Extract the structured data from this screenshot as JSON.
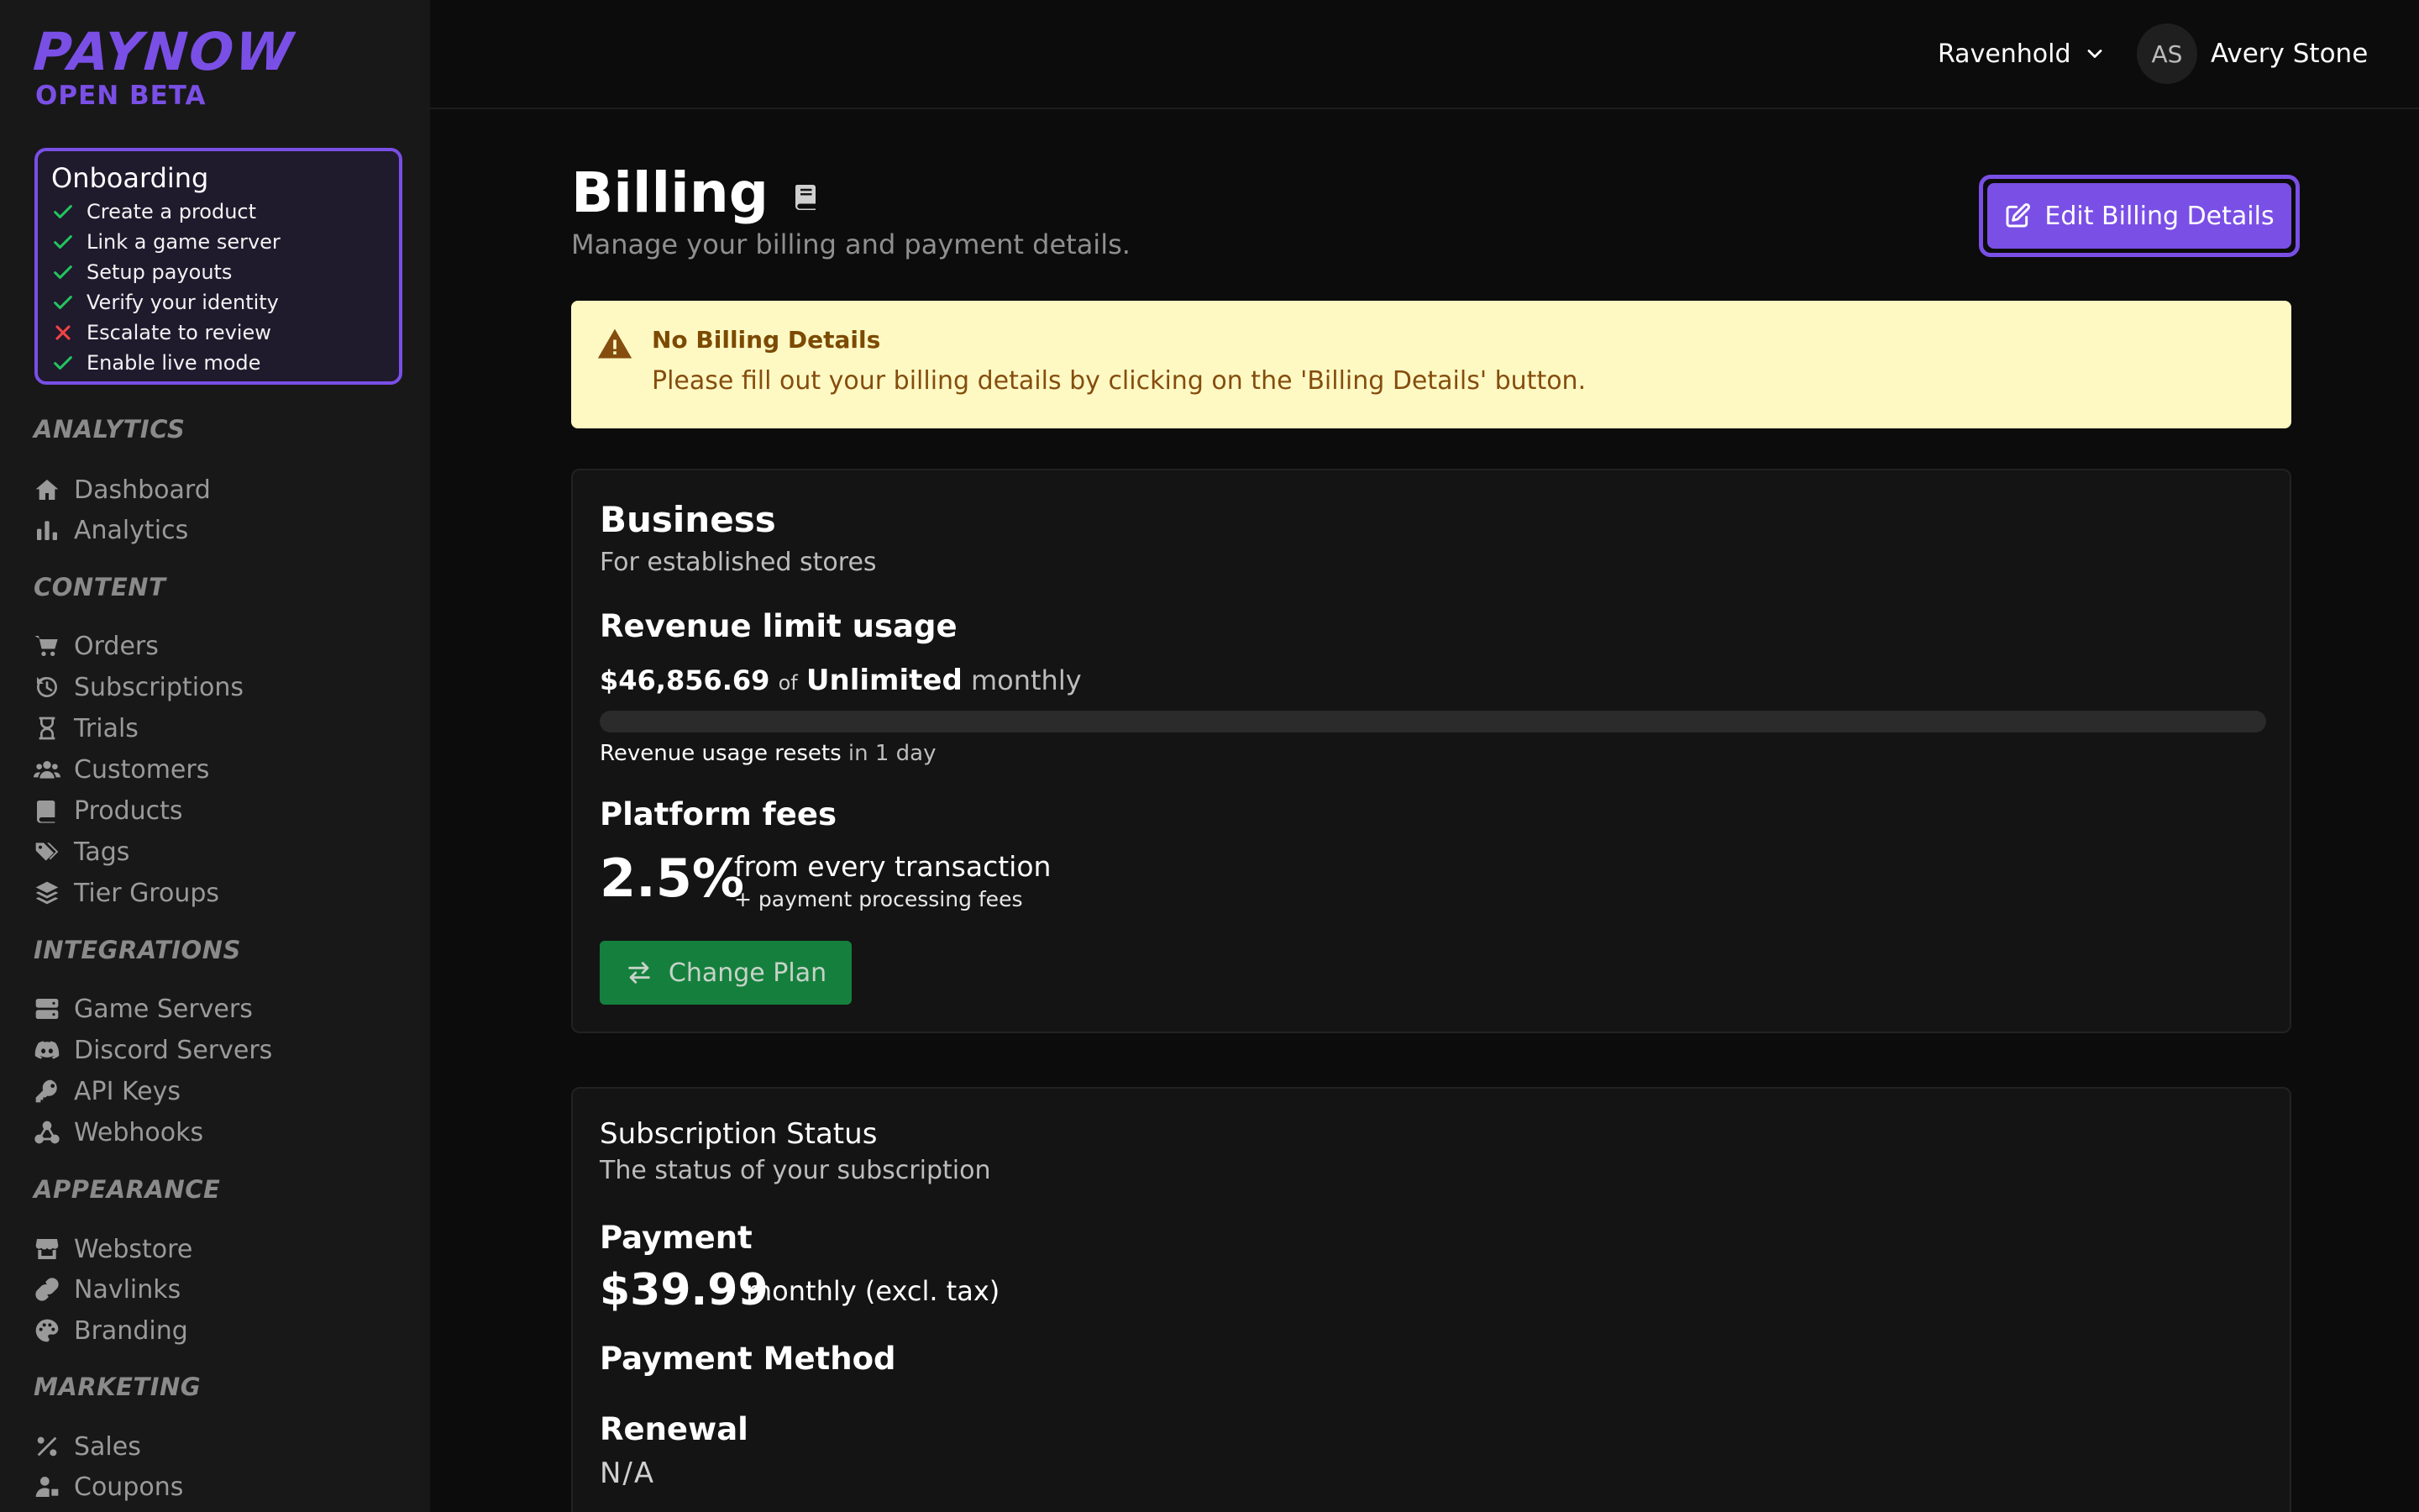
{
  "brand": {
    "name": "PAYNOW",
    "tag": "OPEN BETA"
  },
  "onboarding": {
    "title": "Onboarding",
    "items": [
      {
        "label": "Create a product",
        "status": "done"
      },
      {
        "label": "Link a game server",
        "status": "done"
      },
      {
        "label": "Setup payouts",
        "status": "done"
      },
      {
        "label": "Verify your identity",
        "status": "done"
      },
      {
        "label": "Escalate to review",
        "status": "failed"
      },
      {
        "label": "Enable live mode",
        "status": "done"
      }
    ]
  },
  "nav": {
    "sections": {
      "analytics": "ANALYTICS",
      "content": "CONTENT",
      "integrations": "INTEGRATIONS",
      "appearance": "APPEARANCE",
      "marketing": "MARKETING"
    },
    "items": {
      "dashboard": "Dashboard",
      "analytics": "Analytics",
      "orders": "Orders",
      "subscriptions": "Subscriptions",
      "trials": "Trials",
      "customers": "Customers",
      "products": "Products",
      "tags": "Tags",
      "tier_groups": "Tier Groups",
      "game_servers": "Game Servers",
      "discord_servers": "Discord Servers",
      "api_keys": "API Keys",
      "webhooks": "Webhooks",
      "webstore": "Webstore",
      "navlinks": "Navlinks",
      "branding": "Branding",
      "sales": "Sales",
      "coupons": "Coupons"
    }
  },
  "header": {
    "store": "Ravenhold",
    "user_initials": "AS",
    "user_name": "Avery Stone"
  },
  "page": {
    "title": "Billing",
    "subtitle": "Manage your billing and payment details.",
    "edit_button": "Edit Billing Details"
  },
  "alert": {
    "title": "No Billing Details",
    "text": "Please fill out your billing details by clicking on the 'Billing Details' button."
  },
  "plan": {
    "name": "Business",
    "description": "For established stores",
    "revenue_heading": "Revenue limit usage",
    "revenue_used": "$46,856.69",
    "revenue_of": "of",
    "revenue_limit": "Unlimited",
    "revenue_period": "monthly",
    "usage_fraction": 0,
    "reset_label": "Revenue usage resets",
    "reset_time": "in 1 day",
    "fees_heading": "Platform fees",
    "fee_percent": "2.5%",
    "fee_desc": "from every transaction",
    "fee_extra": "+ payment processing fees",
    "change_button": "Change Plan"
  },
  "subscription": {
    "title": "Subscription Status",
    "description": "The status of your subscription",
    "payment_heading": "Payment",
    "payment_amount": "$39.99",
    "payment_desc": "monthly (excl. tax)",
    "method_heading": "Payment Method",
    "renewal_heading": "Renewal",
    "renewal_value": "N/A"
  },
  "colors": {
    "accent": "#7a4fe6",
    "success": "#22c55e",
    "danger": "#ef4444",
    "warning_bg": "#fef9c3",
    "change_plan": "#15803d"
  }
}
